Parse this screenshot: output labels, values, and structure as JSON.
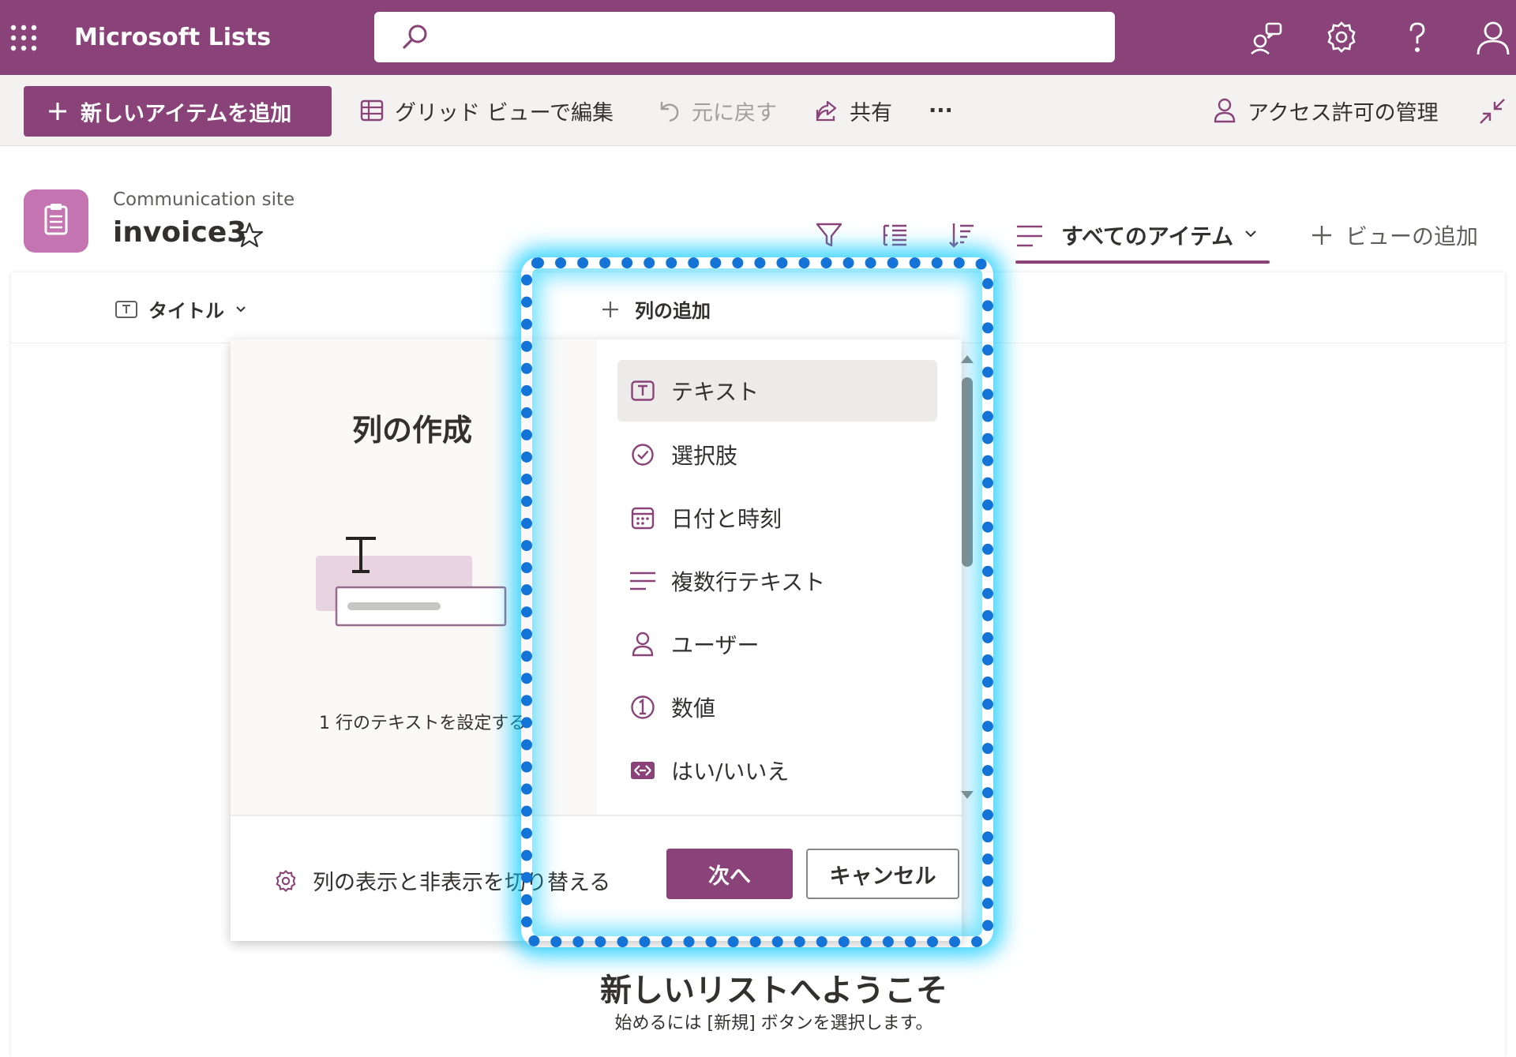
{
  "suite": {
    "app_name": "Microsoft Lists",
    "search_placeholder": ""
  },
  "command_bar": {
    "new_item_label": "新しいアイテムを追加",
    "grid_edit_label": "グリッド ビューで編集",
    "undo_label": "元に戻す",
    "share_label": "共有",
    "more_label": "···",
    "manage_access_label": "アクセス許可の管理"
  },
  "list_header": {
    "site_name": "Communication site",
    "list_name": "invoice3",
    "view_name": "すべてのアイテム",
    "add_view_label": "ビューの追加"
  },
  "columns": {
    "title_label": "タイトル",
    "add_column_label": "列の追加"
  },
  "dialog": {
    "title": "列の作成",
    "description": "1 行のテキストを設定する",
    "toggle_columns_label": "列の表示と非表示を切り替える",
    "next_label": "次へ",
    "cancel_label": "キャンセル",
    "types": [
      {
        "label": "テキスト",
        "icon": "text-box-icon",
        "selected": true
      },
      {
        "label": "選択肢",
        "icon": "check-circle-icon",
        "selected": false
      },
      {
        "label": "日付と時刻",
        "icon": "calendar-icon",
        "selected": false
      },
      {
        "label": "複数行テキスト",
        "icon": "multiline-text-icon",
        "selected": false
      },
      {
        "label": "ユーザー",
        "icon": "person-icon",
        "selected": false
      },
      {
        "label": "数値",
        "icon": "number-circle-icon",
        "selected": false
      },
      {
        "label": "はい/いいえ",
        "icon": "toggle-icon",
        "selected": false
      }
    ]
  },
  "welcome": {
    "title": "新しいリストへようこそ",
    "subtitle": "始めるには [新規] ボタンを選択します。"
  },
  "colors": {
    "brand": "#8a4378",
    "highlight": "#1473d6",
    "glow": "#00c8ff"
  }
}
